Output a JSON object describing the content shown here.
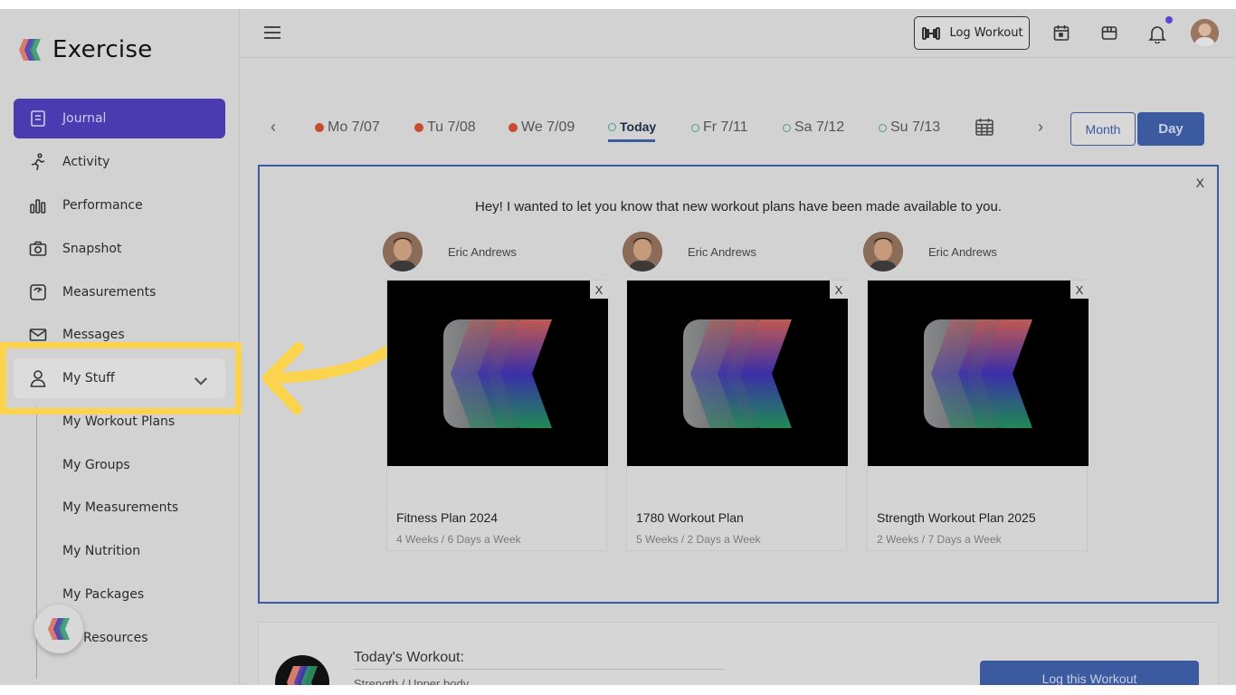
{
  "brand": {
    "name": "Exercise"
  },
  "sidebar": {
    "items": [
      {
        "label": "Journal",
        "icon": "journal-icon"
      },
      {
        "label": "Activity",
        "icon": "running-icon"
      },
      {
        "label": "Performance",
        "icon": "bar-chart-icon"
      },
      {
        "label": "Snapshot",
        "icon": "camera-icon"
      },
      {
        "label": "Measurements",
        "icon": "scale-icon"
      },
      {
        "label": "Messages",
        "icon": "envelope-icon"
      },
      {
        "label": "My Stuff",
        "icon": "user-icon"
      }
    ],
    "sub_items": [
      "My Workout Plans",
      "My Groups",
      "My Measurements",
      "My Nutrition",
      "My Packages",
      "Resources"
    ]
  },
  "topbar": {
    "log_workout": "Log Workout"
  },
  "datestrip": {
    "days": [
      "Mo 7/07",
      "Tu 7/08",
      "We 7/09",
      "Today",
      "Fr 7/11",
      "Sa 7/12",
      "Su 7/13"
    ],
    "month_label": "Month",
    "day_label": "Day"
  },
  "announcement": {
    "close": "X",
    "message": "Hey! I wanted to let you know that new workout plans have been made available to you.",
    "plans": [
      {
        "coach": "Eric Andrews",
        "title": "Fitness Plan 2024",
        "subtitle": "4 Weeks / 6 Days a Week",
        "close": "X"
      },
      {
        "coach": "Eric Andrews",
        "title": "1780 Workout Plan",
        "subtitle": "5 Weeks / 2 Days a Week",
        "close": "X"
      },
      {
        "coach": "Eric Andrews",
        "title": "Strength Workout Plan 2025",
        "subtitle": "2 Weeks / 7 Days a Week",
        "close": "X"
      }
    ]
  },
  "todays_workout": {
    "title": "Today's Workout:",
    "subtitle": "Strength / Upper body",
    "button": "Log this Workout"
  },
  "colors": {
    "accent": "#4b3bb0",
    "primary": "#3b5aa0",
    "highlight": "#fcd34d",
    "past_dot": "#c54b2c"
  }
}
